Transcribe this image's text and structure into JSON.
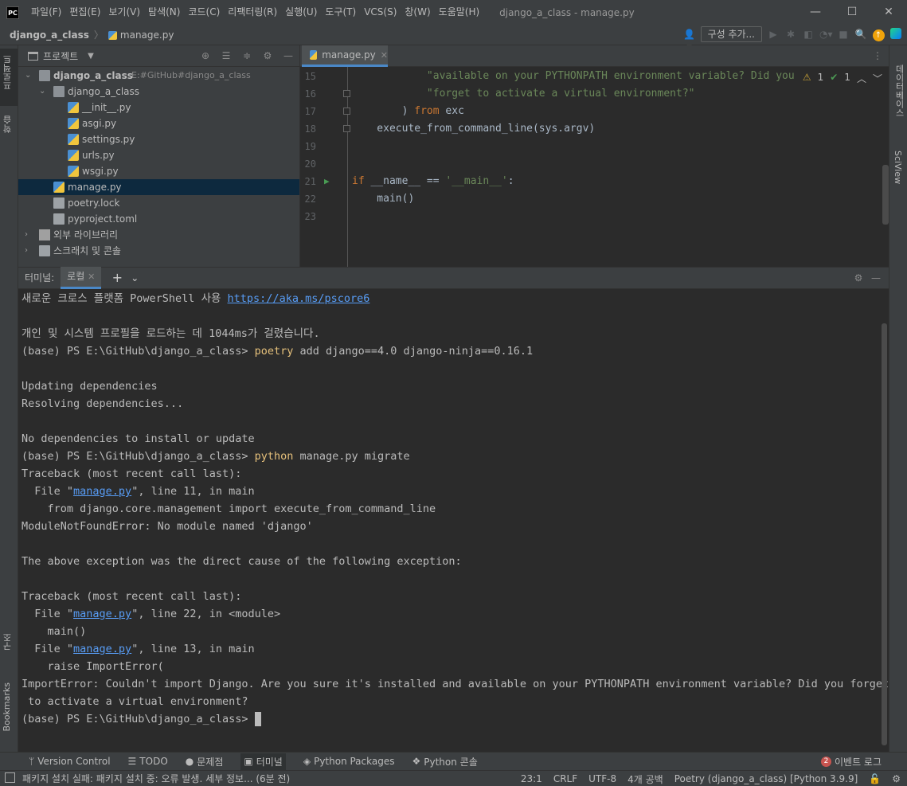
{
  "app": {
    "logo": "PC",
    "menu": [
      "파일(F)",
      "편집(E)",
      "보기(V)",
      "탐색(N)",
      "코드(C)",
      "리팩터링(R)",
      "실행(U)",
      "도구(T)",
      "VCS(S)",
      "창(W)",
      "도움말(H)"
    ],
    "window_title": "django_a_class - manage.py"
  },
  "navbar": {
    "crumbs": [
      "django_a_class",
      "manage.py"
    ],
    "config_button": "구성 추가..."
  },
  "left_strip": {
    "project": "프로젝트",
    "learn": "학습",
    "structure": "구조",
    "bookmarks": "Bookmarks"
  },
  "right_strip": {
    "database": "데이터베이스",
    "sciview": "SciView"
  },
  "project": {
    "title": "프로젝트",
    "tree": [
      {
        "label": "django_a_class",
        "path": "E:#GitHub#django_a_class",
        "depth": 0,
        "type": "folder",
        "open": true
      },
      {
        "label": "django_a_class",
        "depth": 1,
        "type": "folder",
        "open": true
      },
      {
        "label": "__init__.py",
        "depth": 2,
        "type": "py"
      },
      {
        "label": "asgi.py",
        "depth": 2,
        "type": "py"
      },
      {
        "label": "settings.py",
        "depth": 2,
        "type": "py"
      },
      {
        "label": "urls.py",
        "depth": 2,
        "type": "py"
      },
      {
        "label": "wsgi.py",
        "depth": 2,
        "type": "py"
      },
      {
        "label": "manage.py",
        "depth": 1,
        "type": "py",
        "selected": true
      },
      {
        "label": "poetry.lock",
        "depth": 1,
        "type": "file"
      },
      {
        "label": "pyproject.toml",
        "depth": 1,
        "type": "file"
      },
      {
        "label": "외부 라이브러리",
        "depth": 0,
        "type": "lib",
        "open": false
      },
      {
        "label": "스크래치 및 콘솔",
        "depth": 0,
        "type": "scratch",
        "open": false
      }
    ]
  },
  "editor": {
    "tab": "manage.py",
    "inspections": {
      "warnings": "1",
      "weak": "1"
    },
    "lines": [
      {
        "n": "15",
        "parts": [
          [
            "",
            "            "
          ],
          [
            "str",
            "\"available on your PYTHONPATH environment variable? Did you"
          ]
        ]
      },
      {
        "n": "16",
        "parts": [
          [
            "",
            "            "
          ],
          [
            "str",
            "\"forget to activate a virtual environment?\""
          ]
        ]
      },
      {
        "n": "17",
        "parts": [
          [
            "",
            "        ) "
          ],
          [
            "kw",
            "from"
          ],
          [
            "",
            " exc"
          ]
        ]
      },
      {
        "n": "18",
        "parts": [
          [
            "",
            "    execute_from_command_line(sys.argv)"
          ]
        ]
      },
      {
        "n": "19",
        "parts": [
          [
            "",
            ""
          ]
        ]
      },
      {
        "n": "20",
        "parts": [
          [
            "",
            ""
          ]
        ]
      },
      {
        "n": "21",
        "parts": [
          [
            "kw",
            "if"
          ],
          [
            "",
            " __name__ == "
          ],
          [
            "str",
            "'__main__'"
          ],
          [
            "",
            ":"
          ]
        ]
      },
      {
        "n": "22",
        "parts": [
          [
            "",
            "    main()"
          ]
        ]
      },
      {
        "n": "23",
        "parts": [
          [
            "",
            ""
          ]
        ]
      }
    ]
  },
  "terminal": {
    "label": "터미널:",
    "tab": "로컬",
    "lines": [
      [
        [
          "",
          "새로운 크로스 플랫폼 PowerShell 사용 "
        ],
        [
          "link",
          "https://aka.ms/pscore6"
        ]
      ],
      [
        [
          "",
          ""
        ]
      ],
      [
        [
          "",
          "개인 및 시스템 프로필을 로드하는 데 1044ms가 걸렸습니다."
        ]
      ],
      [
        [
          "",
          "(base) PS E:\\GitHub\\django_a_class> "
        ],
        [
          "cmd",
          "poetry"
        ],
        [
          "",
          " add django==4.0 django-ninja==0.16.1"
        ]
      ],
      [
        [
          "",
          ""
        ]
      ],
      [
        [
          "",
          "Updating dependencies"
        ]
      ],
      [
        [
          "",
          "Resolving dependencies..."
        ]
      ],
      [
        [
          "",
          ""
        ]
      ],
      [
        [
          "",
          "No dependencies to install or update"
        ]
      ],
      [
        [
          "",
          "(base) PS E:\\GitHub\\django_a_class> "
        ],
        [
          "cmd",
          "python"
        ],
        [
          "",
          " manage.py migrate"
        ]
      ],
      [
        [
          "",
          "Traceback (most recent call last):"
        ]
      ],
      [
        [
          "",
          "  File \""
        ],
        [
          "link",
          "manage.py"
        ],
        [
          "",
          "\", line 11, in main"
        ]
      ],
      [
        [
          "",
          "    from django.core.management import execute_from_command_line"
        ]
      ],
      [
        [
          "",
          "ModuleNotFoundError: No module named 'django'"
        ]
      ],
      [
        [
          "",
          ""
        ]
      ],
      [
        [
          "",
          "The above exception was the direct cause of the following exception:"
        ]
      ],
      [
        [
          "",
          ""
        ]
      ],
      [
        [
          "",
          "Traceback (most recent call last):"
        ]
      ],
      [
        [
          "",
          "  File \""
        ],
        [
          "link",
          "manage.py"
        ],
        [
          "",
          "\", line 22, in <module>"
        ]
      ],
      [
        [
          "",
          "    main()"
        ]
      ],
      [
        [
          "",
          "  File \""
        ],
        [
          "link",
          "manage.py"
        ],
        [
          "",
          "\", line 13, in main"
        ]
      ],
      [
        [
          "",
          "    raise ImportError("
        ]
      ],
      [
        [
          "",
          "ImportError: Couldn't import Django. Are you sure it's installed and available on your PYTHONPATH environment variable? Did you forget"
        ]
      ],
      [
        [
          "",
          " to activate a virtual environment?"
        ]
      ],
      [
        [
          "",
          "(base) PS E:\\GitHub\\django_a_class> "
        ],
        [
          "cursor",
          ""
        ]
      ]
    ]
  },
  "bottombar": {
    "items": [
      "Version Control",
      "TODO",
      "문제점",
      "터미널",
      "Python Packages",
      "Python 콘솔"
    ],
    "event_count": "2",
    "event_log": "이벤트 로그"
  },
  "statusbar": {
    "message": "패키지 설치 실패: 패키지 설치 중: 오류 발생. 세부 정보... (6분 전)",
    "position": "23:1",
    "line_sep": "CRLF",
    "encoding": "UTF-8",
    "indent": "4개 공백",
    "interpreter": "Poetry (django_a_class) [Python 3.9.9]"
  }
}
